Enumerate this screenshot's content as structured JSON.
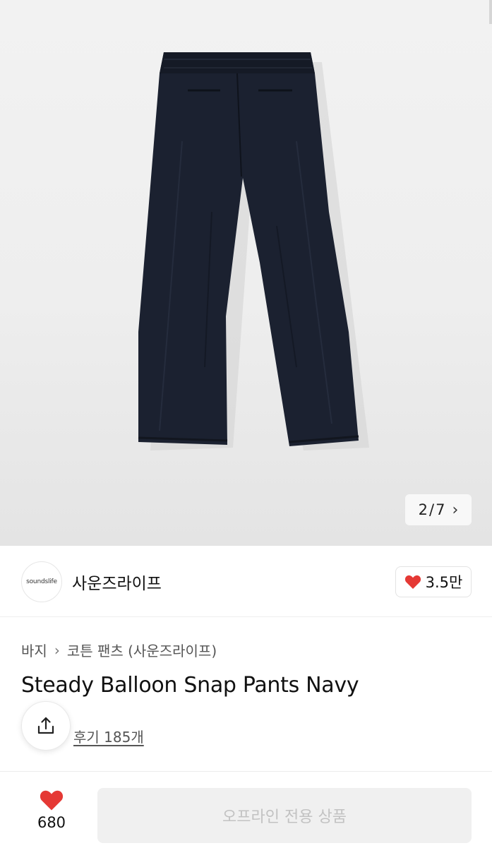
{
  "gallery": {
    "current_page": "2",
    "separator": "/",
    "total_pages": "7",
    "next_icon": "chevron-right-icon"
  },
  "brand": {
    "logo_text": "soundslife",
    "name": "사운즈라이프",
    "likes": "3.5만",
    "like_icon": "heart-icon",
    "heart_color": "#e53935"
  },
  "breadcrumb": {
    "category": "바지",
    "subcategory": "코튼 팬츠 (사운즈라이프)"
  },
  "product": {
    "title": "Steady Balloon Snap Pants Navy",
    "reviews": "후기 185개",
    "share_icon": "share-icon",
    "color": "#1b2130"
  },
  "bottom_bar": {
    "like_count": "680",
    "cta_label": "오프라인 전용 상품",
    "cta_bg": "#f0f0f0"
  }
}
